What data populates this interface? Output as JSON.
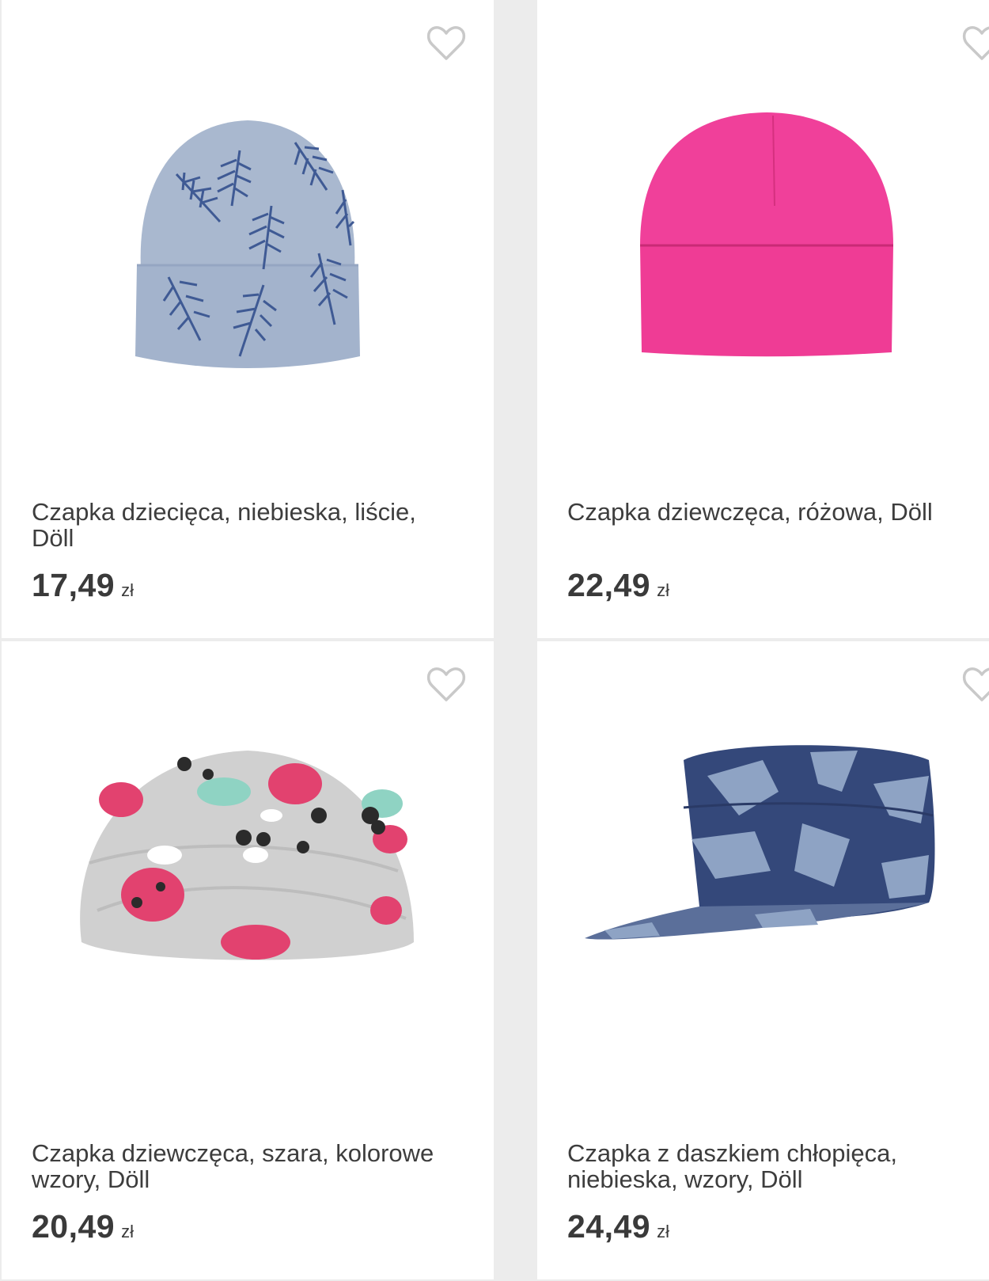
{
  "products": [
    {
      "name": "Czapka dziecięca, niebieska, liście, Döll",
      "price": "17,49",
      "currency": "zł",
      "image_icon": "blue-leaf-print-beanie",
      "color": "#a9b8cf"
    },
    {
      "name": "Czapka dziewczęca, różowa, Döll",
      "price": "22,49",
      "currency": "zł",
      "image_icon": "pink-beanie",
      "color": "#f0409a"
    },
    {
      "name": "Czapka dziewczęca, szara, kolorowe wzory, Döll",
      "price": "20,49",
      "currency": "zł",
      "image_icon": "grey-patterned-slouch-hat",
      "color": "#cfcfcf"
    },
    {
      "name": "Czapka z daszkiem chłopięca, niebieska, wzory, Döll",
      "price": "24,49",
      "currency": "zł",
      "image_icon": "blue-camo-cap",
      "color": "#34487a"
    }
  ],
  "icons": {
    "favorite": "heart-outline-icon"
  },
  "colors": {
    "background": "#ececec",
    "card": "#ffffff",
    "text": "#3a3a3a",
    "heart_outline": "#c9c9c9"
  }
}
